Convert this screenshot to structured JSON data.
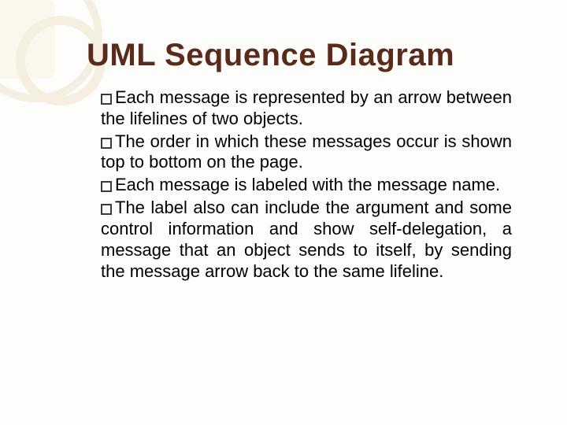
{
  "title": "UML Sequence Diagram",
  "bullets": [
    "Each message is represented by an arrow between the lifelines of two objects.",
    "The order in which these messages occur is shown top to bottom on the page.",
    "Each message is labeled with the message name.",
    "The label also can include the argument and some control information and show self-delegation, a message that an object sends to itself, by sending the message arrow back to the same lifeline."
  ]
}
